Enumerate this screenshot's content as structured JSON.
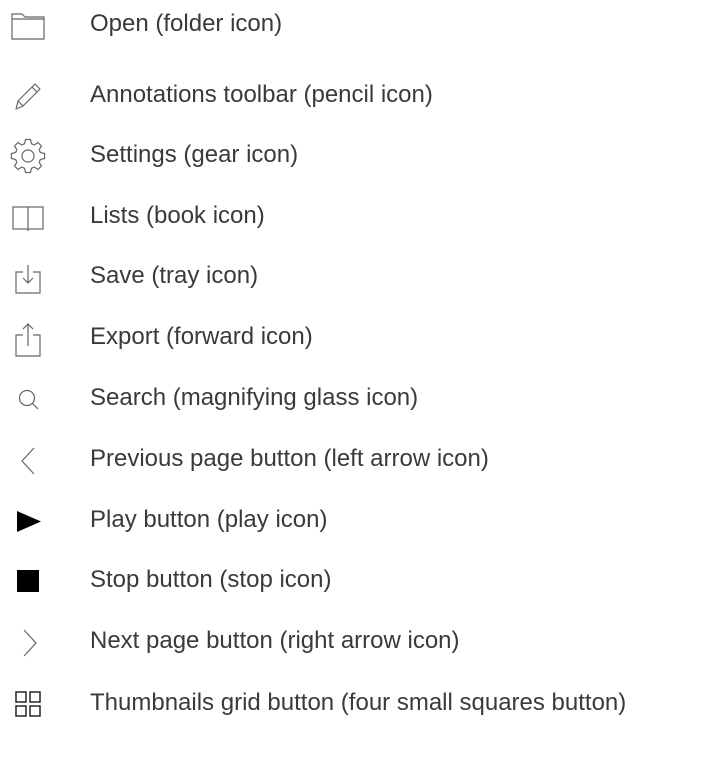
{
  "items": [
    {
      "icon": "folder-icon",
      "label": "Open (folder icon)"
    },
    {
      "icon": "pencil-icon",
      "label": "Annotations toolbar (pencil icon)"
    },
    {
      "icon": "gear-icon",
      "label": "Settings (gear icon)"
    },
    {
      "icon": "book-icon",
      "label": "Lists (book icon)"
    },
    {
      "icon": "tray-icon",
      "label": "Save (tray icon)"
    },
    {
      "icon": "forward-icon",
      "label": "Export (forward icon)"
    },
    {
      "icon": "magnifying-glass-icon",
      "label": "Search (magnifying glass icon)"
    },
    {
      "icon": "left-arrow-icon",
      "label": "Previous page button (left arrow icon)"
    },
    {
      "icon": "play-icon",
      "label": "Play button (play icon)"
    },
    {
      "icon": "stop-icon",
      "label": "Stop button (stop icon)"
    },
    {
      "icon": "right-arrow-icon",
      "label": "Next page button (right arrow icon)"
    },
    {
      "icon": "four-squares-icon",
      "label": "Thumbnails grid button (four small squares button)"
    }
  ],
  "colors": {
    "text": "#3a3a3a",
    "icon_stroke": "#666666",
    "icon_fill": "#000000"
  }
}
